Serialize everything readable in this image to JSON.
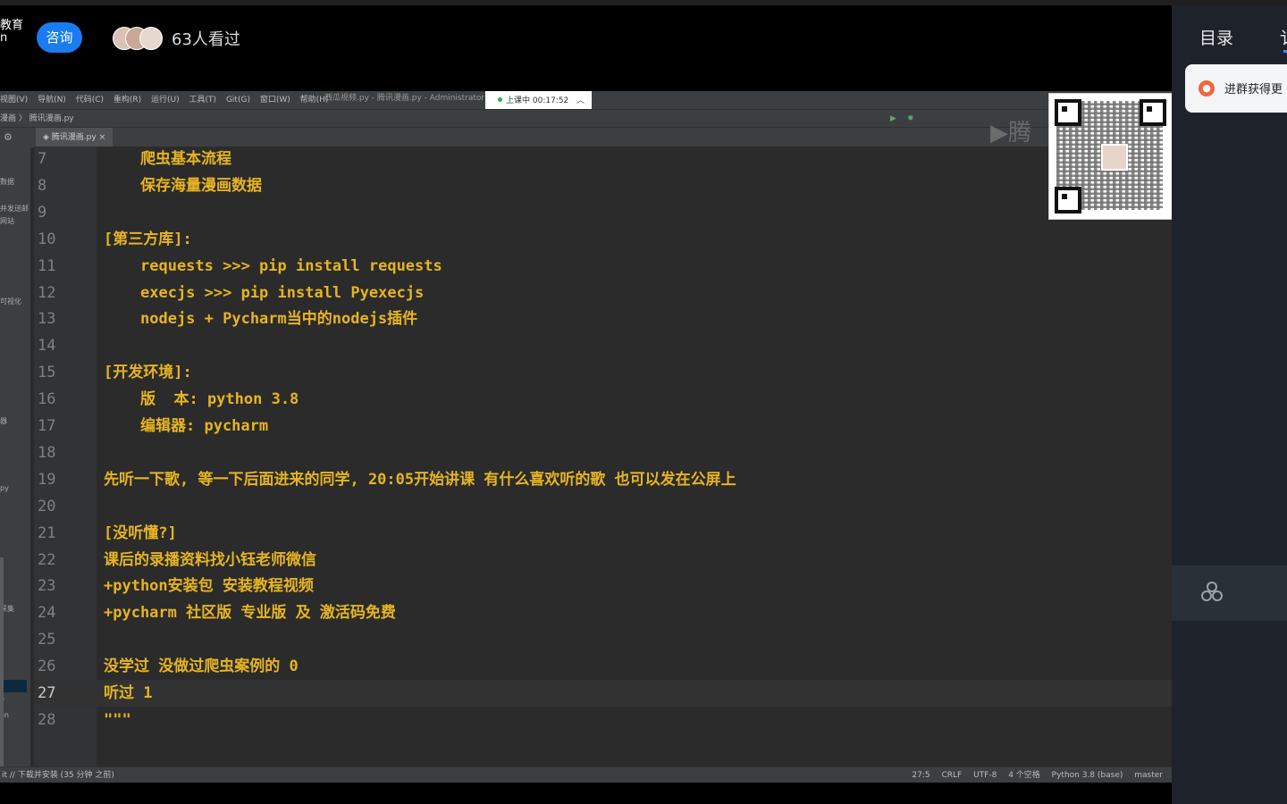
{
  "stream": {
    "brand_partial": "教育\nn",
    "consult_label": "咨询",
    "viewers": "63人看过"
  },
  "ide": {
    "menu": [
      "视图(V)",
      "导航(N)",
      "代码(C)",
      "重构(R)",
      "运行(U)",
      "工具(T)",
      "Git(G)",
      "窗口(W)",
      "帮助(H)"
    ],
    "window_title": "西瓜视频.py - 腾讯漫画.py - Administrator",
    "recording": "上课中 00:17:52",
    "breadcrumb": "漫画 〉 腾讯漫画.py",
    "tab": "腾讯漫画.py",
    "sidebar_labels": [
      "数据",
      "并发送邮",
      "网站",
      "可视化",
      "器",
      "py",
      "采集",
      "e",
      "on"
    ],
    "lines": [
      {
        "n": "7",
        "text": "爬虫基本流程",
        "indent": true
      },
      {
        "n": "8",
        "text": "保存海量漫画数据",
        "indent": true
      },
      {
        "n": "9",
        "text": "",
        "indent": false
      },
      {
        "n": "10",
        "text": "[第三方库]:",
        "indent": false
      },
      {
        "n": "11",
        "text": "requests >>> pip install requests",
        "indent": true
      },
      {
        "n": "12",
        "text": "execjs >>> pip install Pyexecjs",
        "indent": true
      },
      {
        "n": "13",
        "text": "nodejs + Pycharm当中的nodejs插件",
        "indent": true
      },
      {
        "n": "14",
        "text": "",
        "indent": false
      },
      {
        "n": "15",
        "text": "[开发环境]:",
        "indent": false
      },
      {
        "n": "16",
        "text": "版  本: python 3.8",
        "indent": true
      },
      {
        "n": "17",
        "text": "编辑器: pycharm",
        "indent": true
      },
      {
        "n": "18",
        "text": "",
        "indent": false
      },
      {
        "n": "19",
        "text": "先听一下歌, 等一下后面进来的同学, 20:05开始讲课 有什么喜欢听的歌 也可以发在公屏上",
        "indent": false
      },
      {
        "n": "20",
        "text": "",
        "indent": false
      },
      {
        "n": "21",
        "text": "[没听懂?]",
        "indent": false
      },
      {
        "n": "22",
        "text": "课后的录播资料找小钰老师微信",
        "indent": false
      },
      {
        "n": "23",
        "text": "+python安装包 安装教程视频",
        "indent": false
      },
      {
        "n": "24",
        "text": "+pycharm 社区版 专业版 及 激活码免费",
        "indent": false
      },
      {
        "n": "25",
        "text": "",
        "indent": false
      },
      {
        "n": "26",
        "text": "没学过 没做过爬虫案例的 0",
        "indent": false
      },
      {
        "n": "27",
        "text": "听过 1",
        "indent": false
      },
      {
        "n": "28",
        "text": "\"\"\"",
        "indent": false
      }
    ],
    "status_left": "it // 下载并安装 (35 分钟 之前)",
    "status_right": [
      "27:5",
      "CRLF",
      "UTF-8",
      "4 个空格",
      "Python 3.8 (base)",
      "master"
    ]
  },
  "watermark": "腾",
  "panel": {
    "tab_catalog": "目录",
    "tab_partial": "讠",
    "notice": "进群获得更"
  },
  "colors": {
    "code_text": "#e6b422",
    "accent_blue": "#1a7cf0",
    "panel_bg": "#1e232b"
  }
}
